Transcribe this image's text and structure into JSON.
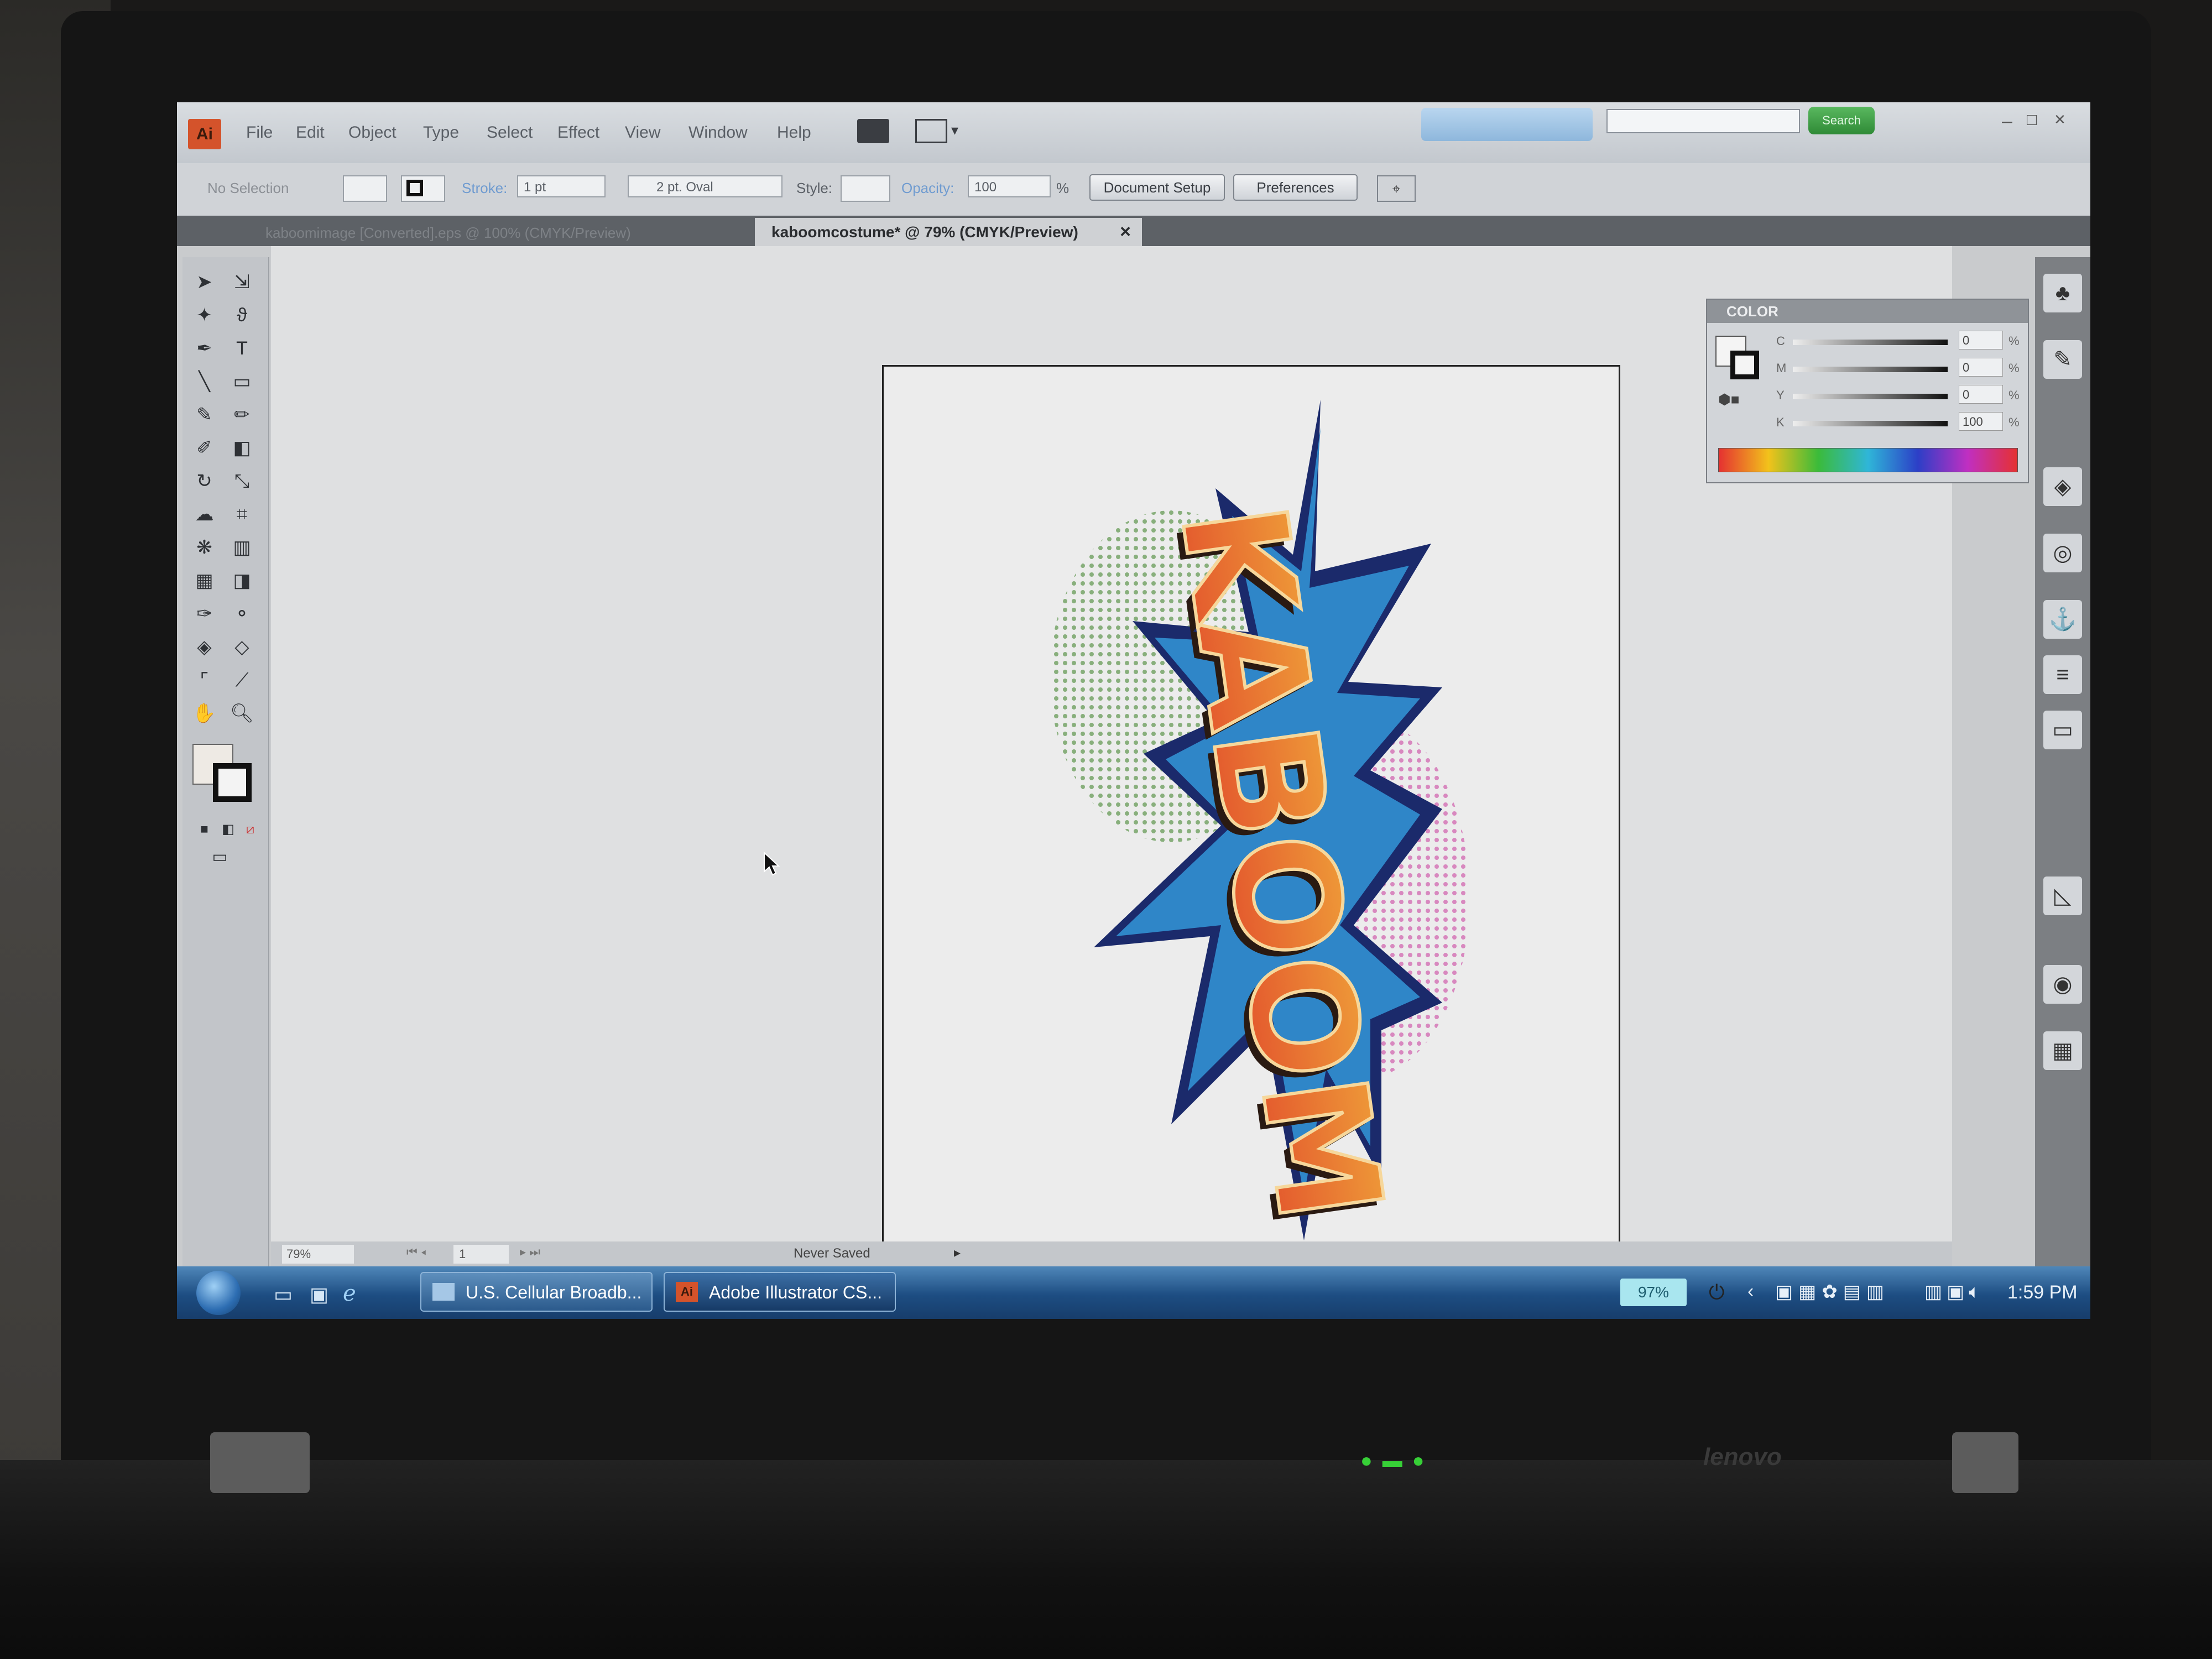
{
  "window": {
    "app_icon": "Ai",
    "menu": [
      "File",
      "Edit",
      "Object",
      "Type",
      "Select",
      "Effect",
      "View",
      "Window",
      "Help"
    ],
    "search_button": "Search"
  },
  "control_bar": {
    "selection_label": "No Selection",
    "stroke_label": "Stroke:",
    "stroke_weight": "1 pt",
    "brush": "2 pt. Oval",
    "style_label": "Style:",
    "opacity_label": "Opacity:",
    "opacity_value": "100",
    "opacity_unit": "%",
    "document_setup_button": "Document Setup",
    "preferences_button": "Preferences"
  },
  "tabs": {
    "inactive": "kaboomimage [Converted].eps @ 100% (CMYK/Preview)",
    "active": "kaboomcostume* @ 79% (CMYK/Preview)",
    "close_glyph": "×"
  },
  "artwork": {
    "text": "KABOOM"
  },
  "color_panel": {
    "title": "COLOR",
    "channels": [
      {
        "label": "C",
        "value": "0",
        "unit": "%"
      },
      {
        "label": "M",
        "value": "0",
        "unit": "%"
      },
      {
        "label": "Y",
        "value": "0",
        "unit": "%"
      },
      {
        "label": "K",
        "value": "100",
        "unit": "%"
      }
    ]
  },
  "status_bar": {
    "zoom": "79%",
    "page": "1",
    "status": "Never Saved"
  },
  "taskbar": {
    "tasks": [
      {
        "label": "U.S. Cellular Broadb...",
        "icon": "browser-window-icon"
      },
      {
        "label": "Adobe Illustrator CS...",
        "icon": "illustrator-icon",
        "icon_text": "Ai"
      }
    ],
    "battery": "97%",
    "clock": "1:59 PM"
  },
  "laptop": {
    "brand": "lenovo"
  },
  "colors": {
    "burst_blue": "#2f86c8",
    "burst_navy": "#1b2a6b",
    "letters_orange": "#f0a53a",
    "letters_red": "#e14a2b",
    "halftone_green": "#6fa060",
    "halftone_pink": "#d36fb4",
    "ai_brand": "#d4532b"
  }
}
